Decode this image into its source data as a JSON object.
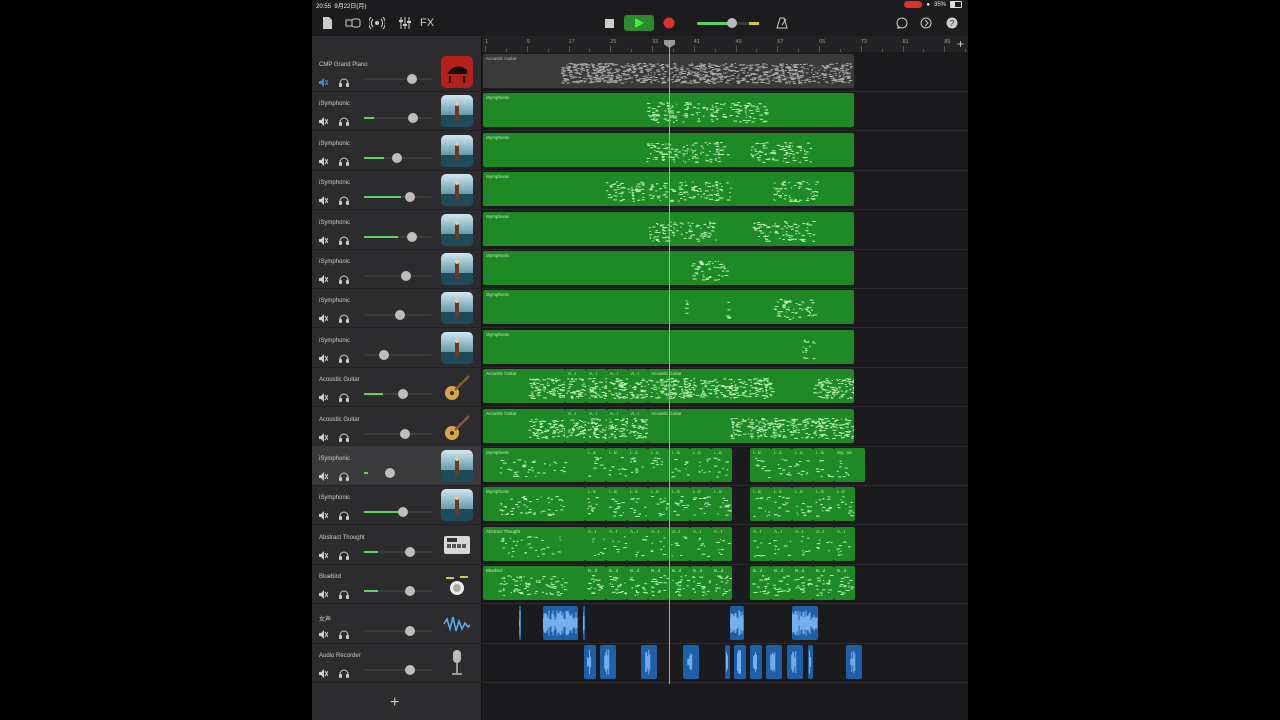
{
  "status": {
    "time": "20:55",
    "date": "9月22日(月)",
    "battery": "35%"
  },
  "toolbar": {
    "fx_label": "FX"
  },
  "ruler": {
    "bars": [
      "1",
      "9",
      "17",
      "25",
      "33",
      "41",
      "49",
      "57",
      "65",
      "73",
      "81",
      "89"
    ],
    "playhead_bar": "33"
  },
  "tracks": [
    {
      "name": "CMP Grand Piano",
      "inst": "piano",
      "volume": 0.7,
      "muted": true
    },
    {
      "name": "iSymphonic",
      "inst": "symphonic",
      "volume": 0.72,
      "level": 0.15
    },
    {
      "name": "iSymphonic",
      "inst": "symphonic",
      "volume": 0.48,
      "level": 0.3
    },
    {
      "name": "iSymphonic",
      "inst": "symphonic",
      "volume": 0.68,
      "level": 0.55
    },
    {
      "name": "iSymphonic",
      "inst": "symphonic",
      "volume": 0.7,
      "level": 0.5
    },
    {
      "name": "iSymphonic",
      "inst": "symphonic",
      "volume": 0.62
    },
    {
      "name": "iSymphonic",
      "inst": "symphonic",
      "volume": 0.53
    },
    {
      "name": "iSymphonic",
      "inst": "symphonic",
      "volume": 0.3
    },
    {
      "name": "Acoustic Guitar",
      "inst": "guitar",
      "volume": 0.58,
      "level": 0.28
    },
    {
      "name": "Acoustic Guitar",
      "inst": "guitar",
      "volume": 0.6
    },
    {
      "name": "iSymphonic",
      "inst": "symphonic",
      "volume": 0.38,
      "level": 0.06,
      "selected": true
    },
    {
      "name": "iSymphonic",
      "inst": "symphonic",
      "volume": 0.57,
      "level": 0.6
    },
    {
      "name": "Abstract Thought",
      "inst": "drum-machine",
      "volume": 0.68,
      "level": 0.2
    },
    {
      "name": "Bluebird",
      "inst": "drum-kit",
      "volume": 0.68,
      "level": 0.2
    },
    {
      "name": "女声",
      "inst": "waveform",
      "volume": 0.68
    },
    {
      "name": "Audio Recorder",
      "inst": "microphone",
      "volume": 0.68
    }
  ],
  "regions": {
    "acoustic_guitar": "Acoustic Guitar",
    "isymphonic": "iSymphonic",
    "abstract_thought": "Abstract Thought",
    "bluebird": "Bluebird",
    "short_a": "A...t",
    "short_a2": "A...r",
    "short_i": "i...ic",
    "short_is": "iS...ic",
    "short_isy": "iSy...nic",
    "short_b": "B...d"
  }
}
